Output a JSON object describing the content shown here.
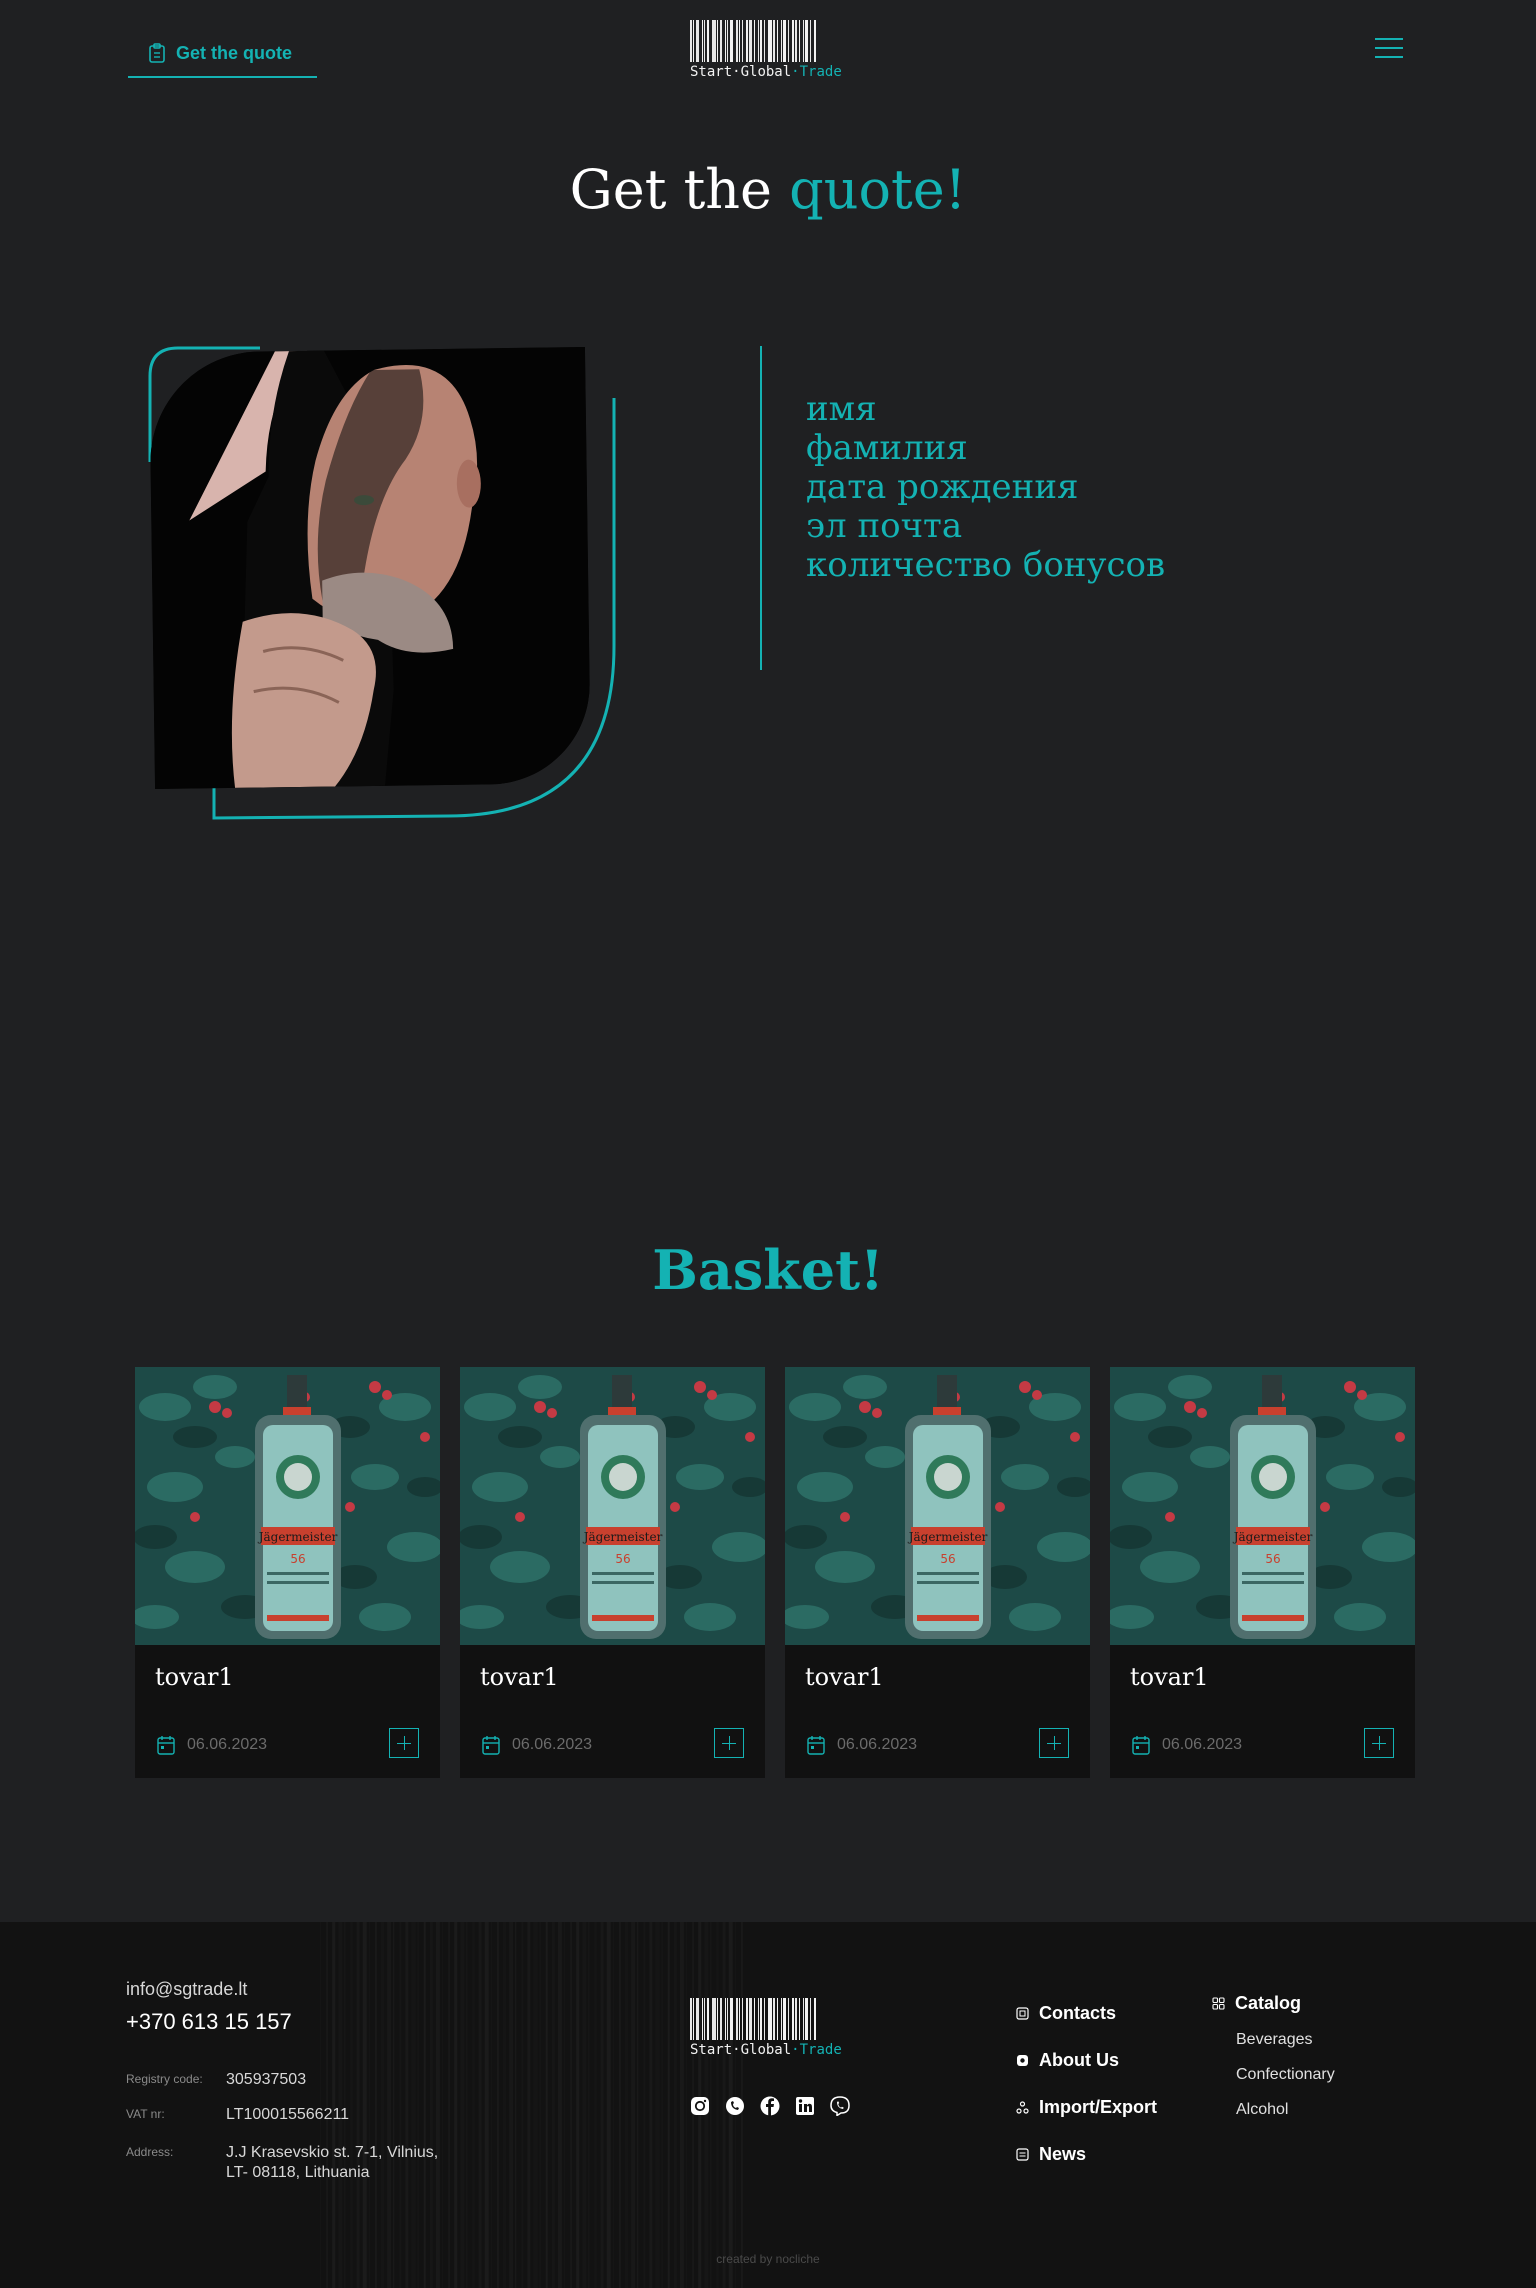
{
  "header": {
    "quote_link": "Get the quote",
    "logo": {
      "part1": "Start",
      "sep1": "·",
      "part2": "Global",
      "sep2": "·",
      "part3": "Trade"
    }
  },
  "title": {
    "main": "Get the ",
    "accent": "quote!"
  },
  "profile": {
    "fields": [
      "имя",
      "фамилия",
      "дата рождения",
      "эл почта",
      "количество бонусов"
    ]
  },
  "basket": {
    "title": "Basket!",
    "items": [
      {
        "name": "tovar1",
        "date": "06.06.2023"
      },
      {
        "name": "tovar1",
        "date": "06.06.2023"
      },
      {
        "name": "tovar1",
        "date": "06.06.2023"
      },
      {
        "name": "tovar1",
        "date": "06.06.2023"
      }
    ]
  },
  "footer": {
    "email": "info@sgtrade.lt",
    "phone": "+370 613 15 157",
    "registry_label": "Registry code:",
    "registry_value": "305937503",
    "vat_label": "VAT nr:",
    "vat_value": "LT100015566211",
    "address_label": "Address:",
    "address_line1": "J.J Krasevskio st. 7-1, Vilnius,",
    "address_line2": "LT- 08118, Lithuania",
    "socials": [
      "instagram-icon",
      "whatsapp-icon",
      "facebook-icon",
      "linkedin-icon",
      "viber-icon"
    ],
    "nav": [
      "Contacts",
      "About Us",
      "Import/Export",
      "News"
    ],
    "catalog_title": "Catalog",
    "catalog_items": [
      "Beverages",
      "Confectionary",
      "Alcohol"
    ],
    "credit": "created by nocliche"
  },
  "colors": {
    "accent": "#14b2b3",
    "background": "#1f2022",
    "footer": "#121212",
    "card": "#111111"
  }
}
